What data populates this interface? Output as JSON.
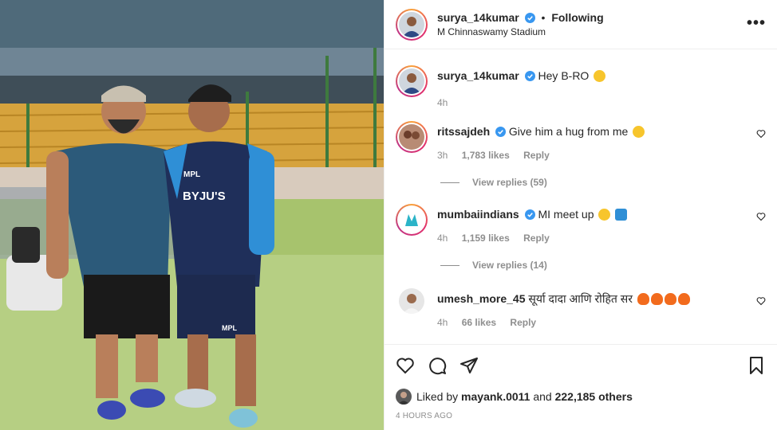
{
  "header": {
    "username": "surya_14kumar",
    "separator": "•",
    "follow_status": "Following",
    "location": "M Chinnaswamy Stadium",
    "more_label": "•••"
  },
  "caption": {
    "username": "surya_14kumar",
    "text": "Hey B-RO",
    "time": "4h",
    "emoji": "sunglasses-emoji"
  },
  "comments": [
    {
      "username": "ritssajdeh",
      "text": "Give him a hug from me",
      "time": "3h",
      "likes": "1,783 likes",
      "reply": "Reply",
      "view_replies": "View replies (59)",
      "emoji": "grin-emoji"
    },
    {
      "username": "mumbaiindians",
      "text": "MI meet up",
      "time": "4h",
      "likes": "1,159 likes",
      "reply": "Reply",
      "view_replies": "View replies (14)",
      "emoji": "smile-heart-emoji"
    },
    {
      "username": "umesh_more_45",
      "text": "सूर्या दादा आणि रोहित सर",
      "time": "4h",
      "likes": "66 likes",
      "reply": "Reply",
      "emoji": "fire-emoji"
    }
  ],
  "photo": {
    "jersey_left_brand": "MPL",
    "jersey_right_brand": "BYJU'S",
    "shorts_brand": "MPL"
  },
  "likes": {
    "prefix": "Liked by",
    "user": "mayank.0011",
    "and": "and",
    "others": "222,185 others"
  },
  "posted_ago": "4 HOURS AGO",
  "colors": {
    "verified": "#3897f0",
    "muted": "#8e8e8e",
    "text": "#262626"
  }
}
